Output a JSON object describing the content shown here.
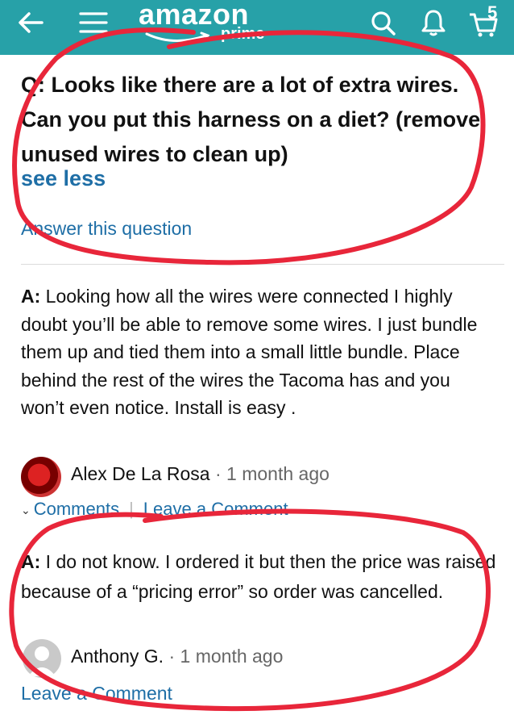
{
  "header": {
    "logo_text": "amazon",
    "prime_text": "prime",
    "cart_count": "5",
    "background": "#27a1a8"
  },
  "question": {
    "text": "Q: Looks like there are a lot of extra wires. Can you put this harness on a diet? (remove unused wires to clean up)",
    "see_less": "see less",
    "answer_link": "Answer this question"
  },
  "answers": [
    {
      "prefix": "A:",
      "text": " Looking how all the wires were connected I highly doubt you’ll be able to remove some wires. I just bundle them up and tied them into a small little bundle. Place behind the rest of the wires the Tacoma has and you won’t even notice. Install is easy .",
      "author": "Alex De La Rosa",
      "time": " · 1 month ago",
      "comments_link": "Comments",
      "leave_comment": "Leave a Comment"
    },
    {
      "prefix": "A:",
      "text": " I do not know. I ordered it but then the price was raised because of a “pricing error” so order was cancelled.",
      "author": "Anthony G.",
      "time": " · 1 month ago",
      "leave_comment": "Leave a Comment"
    }
  ],
  "colors": {
    "link": "#1e6ea6",
    "annotation": "#e8263a"
  }
}
